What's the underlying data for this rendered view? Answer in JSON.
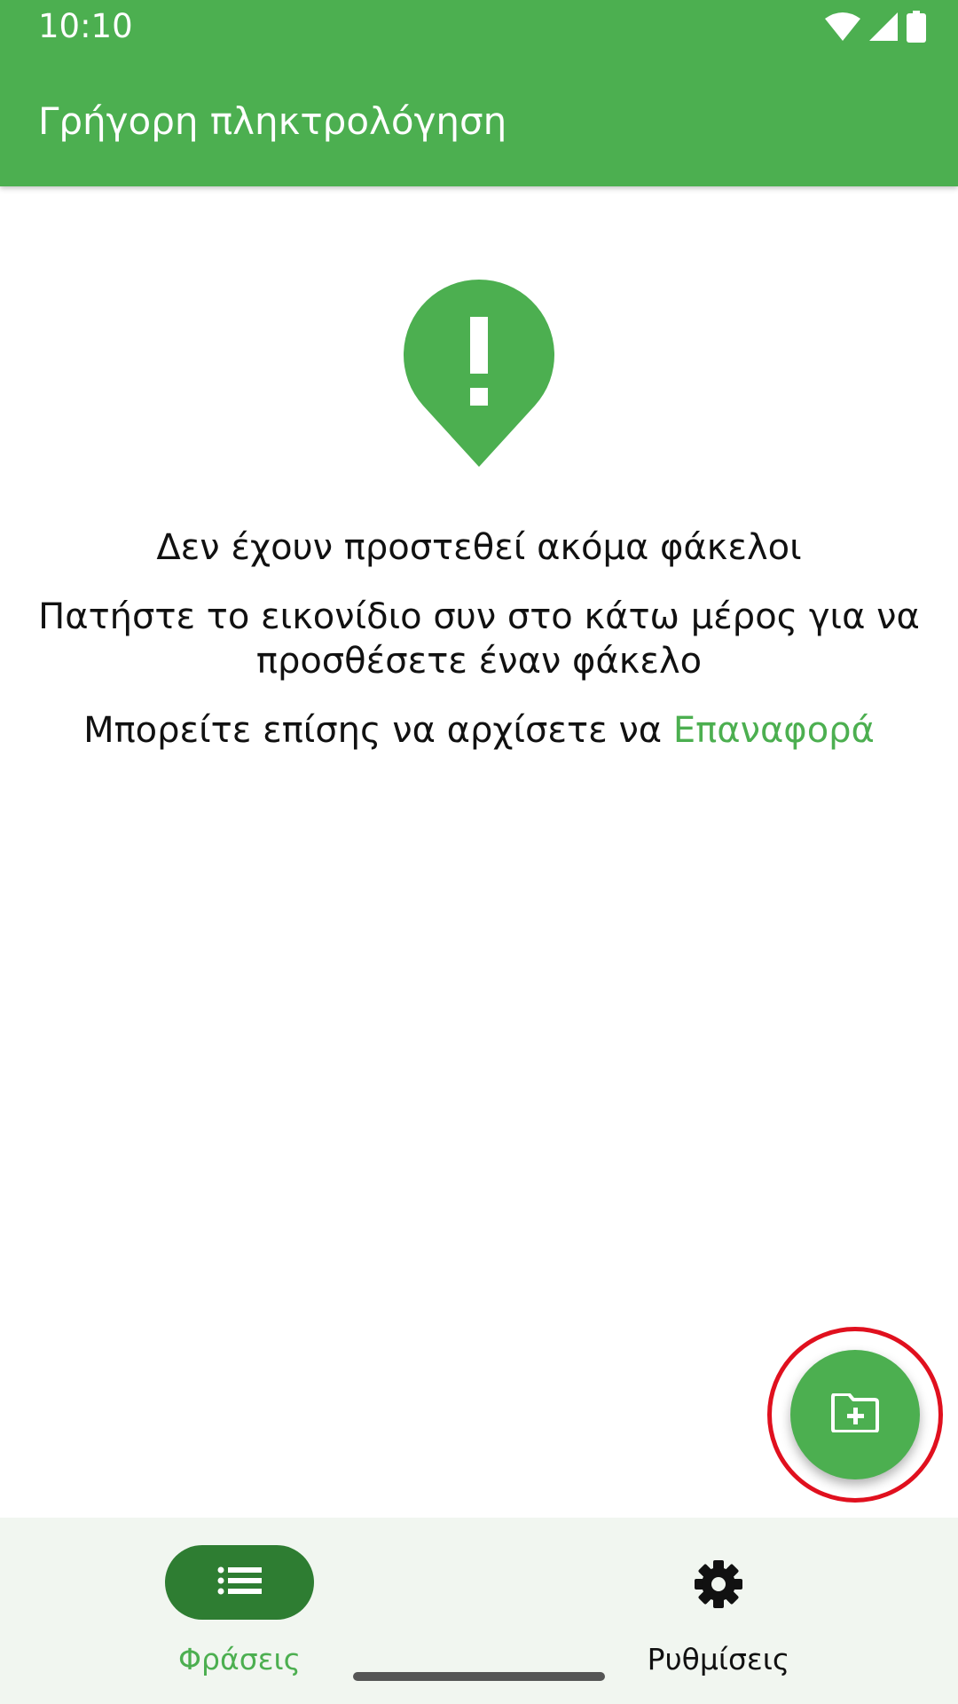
{
  "status_bar": {
    "time": "10:10",
    "icons": [
      "wifi-icon",
      "signal-icon",
      "battery-icon"
    ]
  },
  "app_bar": {
    "title": "Γρήγορη πληκτρολόγηση"
  },
  "empty_state": {
    "icon": "alert-pin-icon",
    "line1": "Δεν έχουν προστεθεί ακόμα φάκελοι",
    "line2a": "Πατήστε το εικονίδιο συν στο κάτω μέρος για να",
    "line2b": "προσθέσετε έναν φάκελο",
    "line3_prefix": "Μπορείτε επίσης να αρχίσετε να ",
    "line3_link": "Επαναφορά"
  },
  "fab": {
    "icon": "add-folder-icon",
    "highlighted": true
  },
  "bottom_nav": {
    "items": [
      {
        "label": "Φράσεις",
        "icon": "list-icon",
        "active": true
      },
      {
        "label": "Ρυθμίσεις",
        "icon": "gear-icon",
        "active": false
      }
    ]
  },
  "colors": {
    "primary": "#4caf50",
    "primary_dark": "#2e7d32",
    "nav_background": "#f1f6f0",
    "highlight_ring": "#e0101e"
  }
}
